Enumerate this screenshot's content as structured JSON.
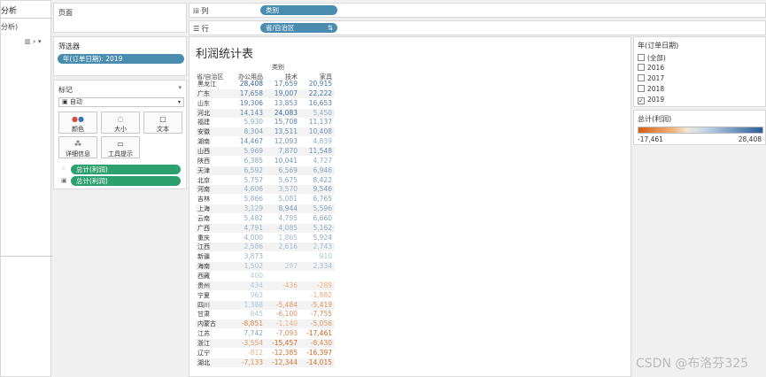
{
  "analysis_pane": {
    "tab": "分析",
    "subtitle": "分析)",
    "tools": "▥ ⌕ ▾"
  },
  "pages": {
    "title": "页面"
  },
  "filters": {
    "title": "筛选器",
    "pill": "年(订单日期): 2019"
  },
  "marks": {
    "title": "标记",
    "type": "自动",
    "buttons": [
      {
        "label": "颜色",
        "icon": "color-icon"
      },
      {
        "label": "大小",
        "icon": "size-icon"
      },
      {
        "label": "文本",
        "icon": "text-icon"
      },
      {
        "label": "详细信息",
        "icon": "detail-icon"
      },
      {
        "label": "工具提示",
        "icon": "tooltip-icon"
      }
    ],
    "pills": [
      "总计(利润)",
      "总计(利润)"
    ]
  },
  "columns_shelf": {
    "label": "iii 列",
    "pill": "类别"
  },
  "rows_shelf": {
    "label": "☰ 行",
    "pill": "省/自治区"
  },
  "view": {
    "title": "利润统计表",
    "category_label": "类别",
    "row_header": "省/自治区",
    "columns": [
      "办公用品",
      "技术",
      "家具"
    ]
  },
  "table": [
    {
      "p": "黑龙江",
      "v": [
        "28,408",
        "17,659",
        "20,915"
      ]
    },
    {
      "p": "广东",
      "v": [
        "17,658",
        "19,007",
        "22,222"
      ]
    },
    {
      "p": "山东",
      "v": [
        "19,306",
        "13,853",
        "16,653"
      ]
    },
    {
      "p": "河北",
      "v": [
        "14,143",
        "24,083",
        "5,450"
      ]
    },
    {
      "p": "福建",
      "v": [
        "5,930",
        "15,708",
        "11,137"
      ]
    },
    {
      "p": "安徽",
      "v": [
        "8,304",
        "13,511",
        "10,408"
      ]
    },
    {
      "p": "湖南",
      "v": [
        "14,467",
        "12,093",
        "4,839"
      ]
    },
    {
      "p": "山西",
      "v": [
        "5,969",
        "7,870",
        "11,548"
      ]
    },
    {
      "p": "陕西",
      "v": [
        "6,385",
        "10,041",
        "4,727"
      ]
    },
    {
      "p": "天津",
      "v": [
        "6,592",
        "6,569",
        "6,946"
      ]
    },
    {
      "p": "北京",
      "v": [
        "5,757",
        "5,675",
        "8,422"
      ]
    },
    {
      "p": "河南",
      "v": [
        "4,606",
        "3,570",
        "9,546"
      ]
    },
    {
      "p": "吉林",
      "v": [
        "5,866",
        "5,081",
        "6,765"
      ]
    },
    {
      "p": "上海",
      "v": [
        "3,129",
        "8,944",
        "5,596"
      ]
    },
    {
      "p": "云南",
      "v": [
        "5,482",
        "4,795",
        "6,660"
      ]
    },
    {
      "p": "广西",
      "v": [
        "4,791",
        "4,085",
        "5,162"
      ]
    },
    {
      "p": "重庆",
      "v": [
        "4,000",
        "1,865",
        "5,924"
      ]
    },
    {
      "p": "江西",
      "v": [
        "2,586",
        "2,616",
        "2,743"
      ]
    },
    {
      "p": "新疆",
      "v": [
        "3,873",
        "",
        "910"
      ]
    },
    {
      "p": "海南",
      "v": [
        "1,502",
        "297",
        "2,334"
      ]
    },
    {
      "p": "西藏",
      "v": [
        "400",
        "",
        ""
      ]
    },
    {
      "p": "贵州",
      "v": [
        "434",
        "-436",
        "-289"
      ]
    },
    {
      "p": "宁夏",
      "v": [
        "963",
        "",
        "-1,882"
      ]
    },
    {
      "p": "四川",
      "v": [
        "1,388",
        "-5,484",
        "-5,419"
      ]
    },
    {
      "p": "甘肃",
      "v": [
        "645",
        "-6,100",
        "-7,755"
      ]
    },
    {
      "p": "内蒙古",
      "v": [
        "-8,851",
        "-1,140",
        "-5,056"
      ]
    },
    {
      "p": "江苏",
      "v": [
        "7,742",
        "-7,093",
        "-17,461"
      ]
    },
    {
      "p": "浙江",
      "v": [
        "-3,554",
        "-15,457",
        "-8,430"
      ]
    },
    {
      "p": "辽宁",
      "v": [
        "-812",
        "-12,385",
        "-16,397"
      ]
    },
    {
      "p": "湖北",
      "v": [
        "-7,133",
        "-12,344",
        "-14,015"
      ]
    }
  ],
  "year_filter": {
    "title": "年(订单日期)",
    "options": [
      {
        "label": "(全部)",
        "checked": false
      },
      {
        "label": "2016",
        "checked": false
      },
      {
        "label": "2017",
        "checked": false
      },
      {
        "label": "2018",
        "checked": false
      },
      {
        "label": "2019",
        "checked": true
      }
    ]
  },
  "color_legend": {
    "title": "总计(利润)",
    "min": "-17,461",
    "max": "28,408",
    "colors": {
      "neg": "#d45f12",
      "mid": "#f2e9df",
      "pos": "#2a5d98"
    }
  },
  "watermark": "CSDN @布洛芬325"
}
